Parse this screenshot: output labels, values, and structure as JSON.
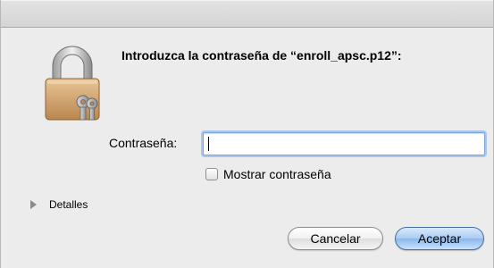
{
  "dialog": {
    "prompt": "Introduzca la contraseña de “enroll_apsc.p12”:",
    "lock_icon": "padlock-keys-icon"
  },
  "password": {
    "label": "Contraseña:",
    "value": ""
  },
  "show_password": {
    "label": "Mostrar contraseña",
    "checked": false
  },
  "details": {
    "label": "Detalles",
    "icon": "disclosure-triangle-right-icon"
  },
  "buttons": {
    "cancel": "Cancelar",
    "accept": "Aceptar"
  },
  "colors": {
    "background": "#ececec",
    "accent": "#8ab7ee",
    "focus_ring": "#a8c6ee"
  }
}
